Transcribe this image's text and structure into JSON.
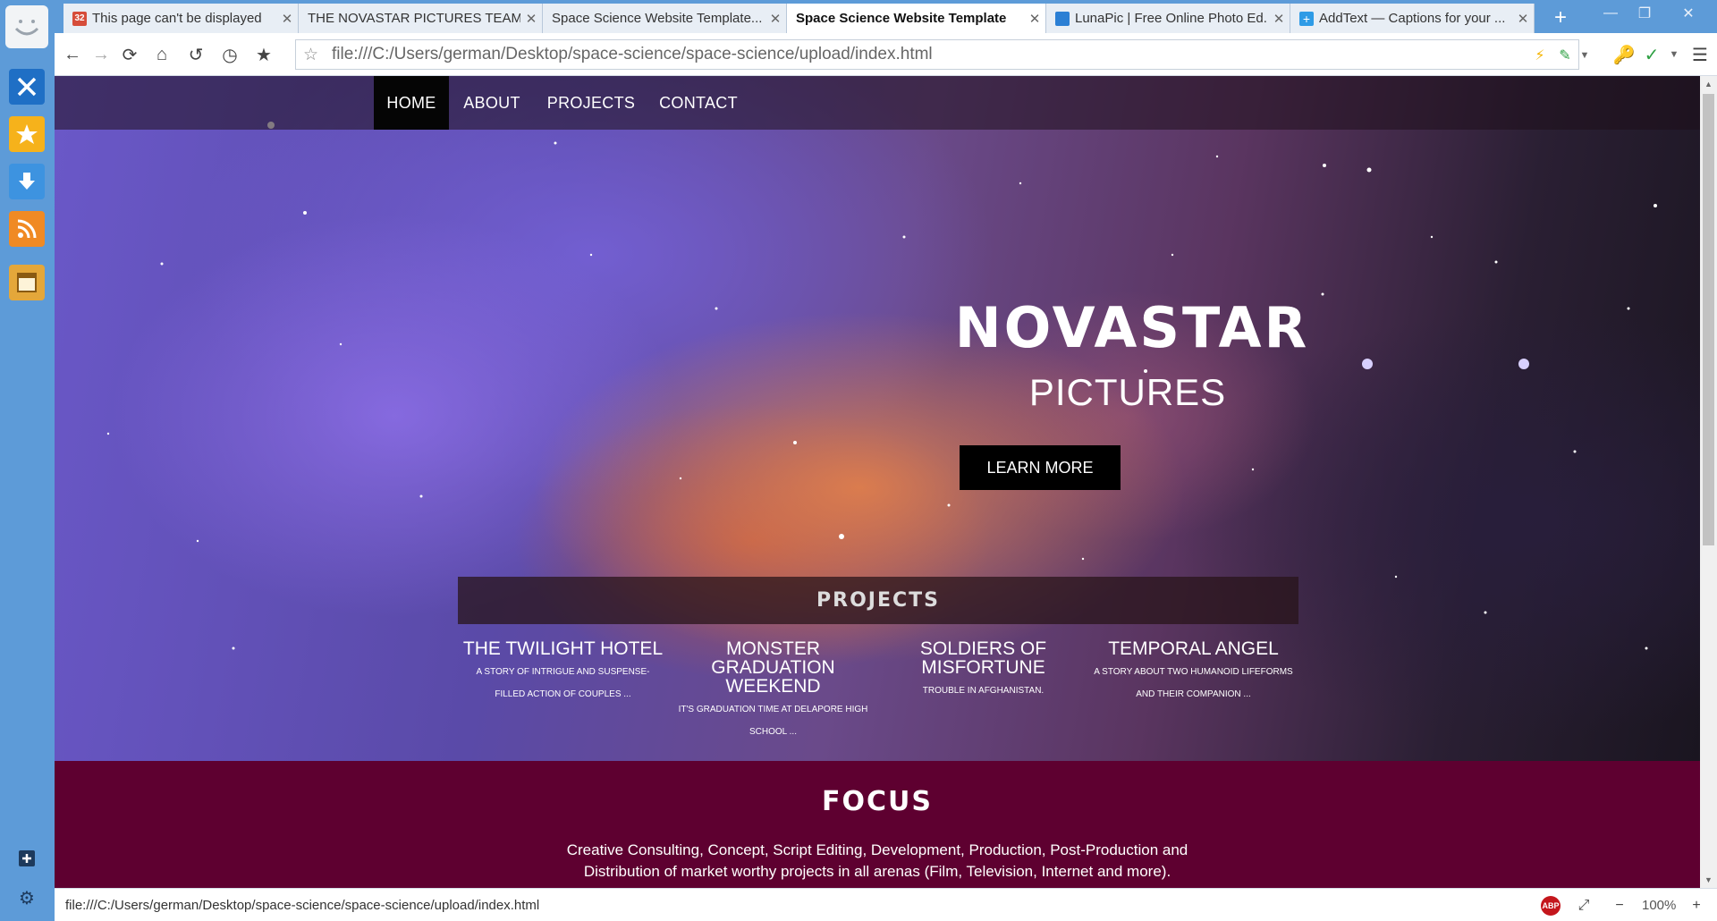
{
  "browser": {
    "tabs": [
      {
        "title": "This page can't be displayed",
        "favicon": "calendar-32-icon",
        "active": false
      },
      {
        "title": "THE NOVASTAR PICTURES TEAM",
        "favicon": "",
        "active": false
      },
      {
        "title": "Space Science Website Template...",
        "favicon": "",
        "active": false
      },
      {
        "title": "Space Science Website Template",
        "favicon": "",
        "active": true
      },
      {
        "title": "LunaPic | Free Online Photo Ed...",
        "favicon": "lunapic-icon",
        "active": false
      },
      {
        "title": "AddText — Captions for your ...",
        "favicon": "addtext-icon",
        "active": false
      }
    ],
    "tab_close": "✕",
    "new_tab": "+",
    "address": "file:///C:/Users/german/Desktop/space-science/space-science/upload/index.html",
    "status_url": "file:///C:/Users/german/Desktop/space-science/space-science/upload/index.html",
    "zoom": "100%",
    "abp_label": "ABP",
    "favicon_32": "32",
    "colors": {
      "sidebar": "#5d9bd8",
      "accent_focus": "#5e0030"
    }
  },
  "page": {
    "nav": [
      {
        "label": "HOME",
        "active": true
      },
      {
        "label": "ABOUT",
        "active": false
      },
      {
        "label": "PROJECTS",
        "active": false
      },
      {
        "label": "CONTACT",
        "active": false
      }
    ],
    "hero": {
      "title": "NOVASTAR",
      "subtitle": "PICTURES",
      "button": "LEARN MORE"
    },
    "projects": {
      "heading": "PROJECTS",
      "items": [
        {
          "title": "THE TWILIGHT HOTEL",
          "desc": "A STORY OF INTRIGUE AND SUSPENSE-FILLED ACTION OF COUPLES ..."
        },
        {
          "title": "MONSTER GRADUATION WEEKEND",
          "desc": "IT'S GRADUATION TIME AT DELAPORE HIGH SCHOOL ..."
        },
        {
          "title": "SOLDIERS OF MISFORTUNE",
          "desc": "TROUBLE IN AFGHANISTAN."
        },
        {
          "title": "TEMPORAL ANGEL",
          "desc": "A STORY ABOUT TWO HUMANOID LIFEFORMS AND THEIR COMPANION ..."
        }
      ]
    },
    "focus": {
      "title": "FOCUS",
      "text": "Creative Consulting, Concept, Script Editing, Development, Production, Post-Production and Distribution of market worthy projects in all arenas (Film, Television, Internet and more)."
    }
  }
}
